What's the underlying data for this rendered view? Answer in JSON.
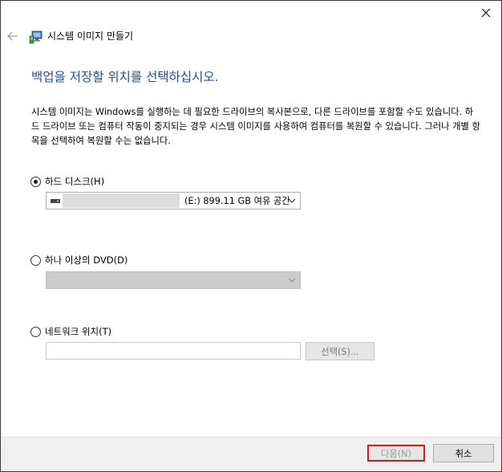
{
  "window": {
    "title": "시스템 이미지 만들기"
  },
  "icons": {
    "back": "back-arrow-icon",
    "close": "close-icon",
    "app": "system-image-icon",
    "drive": "hard-drive-icon",
    "chevron": "chevron-down-icon"
  },
  "heading": "백업을 저장할 위치를 선택하십시오.",
  "description": "시스템 이미지는 Windows를 실행하는 데 필요한 드라이브의 복사본으로, 다른 드라이브를 포함할 수도 있습니다. 하드 드라이브 또는 컴퓨터 작동이 중지되는 경우 시스템 이미지를 사용하여 컴퓨터를 복원할 수 있습니다. 그러나 개별 항목을 선택하여 복원할 수는 없습니다.",
  "options": {
    "hard_disk": {
      "label": "하드 디스크(H)",
      "selected": true,
      "drive_value": "(E:)  899.11 GB 여유 공간"
    },
    "dvd": {
      "label": "하나 이상의 DVD(D)",
      "selected": false,
      "drive_value": ""
    },
    "network": {
      "label": "네트워크 위치(T)",
      "selected": false,
      "input_value": "",
      "select_label": "선택(S)..."
    }
  },
  "buttons": {
    "next": "다음(N)",
    "cancel": "취소"
  },
  "colors": {
    "heading": "#1e4fa5",
    "highlight": "#e0141e",
    "footer": "#f0f0f0"
  }
}
